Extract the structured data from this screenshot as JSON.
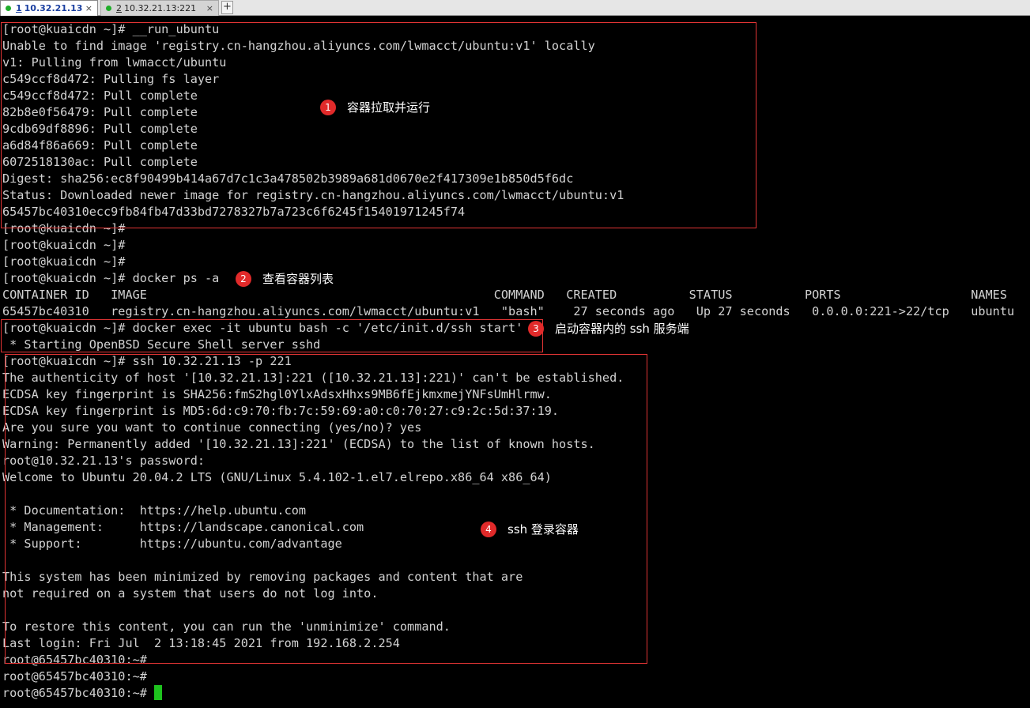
{
  "tabs": [
    {
      "num": "1",
      "host": "10.32.21.13",
      "close": "×"
    },
    {
      "num": "2",
      "host": "10.32.21.13:221",
      "close": "×"
    }
  ],
  "add_tab": "+",
  "terminal": {
    "lines": [
      "[root@kuaicdn ~]# __run_ubuntu",
      "Unable to find image 'registry.cn-hangzhou.aliyuncs.com/lwmacct/ubuntu:v1' locally",
      "v1: Pulling from lwmacct/ubuntu",
      "c549ccf8d472: Pulling fs layer",
      "c549ccf8d472: Pull complete",
      "82b8e0f56479: Pull complete",
      "9cdb69df8896: Pull complete",
      "a6d84f86a669: Pull complete",
      "6072518130ac: Pull complete",
      "Digest: sha256:ec8f90499b414a67d7c1c3a478502b3989a681d0670e2f417309e1b850d5f6dc",
      "Status: Downloaded newer image for registry.cn-hangzhou.aliyuncs.com/lwmacct/ubuntu:v1",
      "65457bc40310ecc9fb84fb47d33bd7278327b7a723c6f6245f15401971245f74",
      "[root@kuaicdn ~]#",
      "[root@kuaicdn ~]#",
      "[root@kuaicdn ~]#",
      "[root@kuaicdn ~]# docker ps -a",
      "CONTAINER ID   IMAGE                                                COMMAND   CREATED          STATUS          PORTS                  NAMES",
      "65457bc40310   registry.cn-hangzhou.aliyuncs.com/lwmacct/ubuntu:v1   \"bash\"    27 seconds ago   Up 27 seconds   0.0.0.0:221->22/tcp   ubuntu",
      "[root@kuaicdn ~]# docker exec -it ubuntu bash -c '/etc/init.d/ssh start'",
      " * Starting OpenBSD Secure Shell server sshd",
      "[root@kuaicdn ~]# ssh 10.32.21.13 -p 221",
      "The authenticity of host '[10.32.21.13]:221 ([10.32.21.13]:221)' can't be established.",
      "ECDSA key fingerprint is SHA256:fmS2hgl0YlxAdsxHhxs9MB6fEjkmxmejYNFsUmHlrmw.",
      "ECDSA key fingerprint is MD5:6d:c9:70:fb:7c:59:69:a0:c0:70:27:c9:2c:5d:37:19.",
      "Are you sure you want to continue connecting (yes/no)? yes",
      "Warning: Permanently added '[10.32.21.13]:221' (ECDSA) to the list of known hosts.",
      "root@10.32.21.13's password:",
      "Welcome to Ubuntu 20.04.2 LTS (GNU/Linux 5.4.102-1.el7.elrepo.x86_64 x86_64)",
      "",
      " * Documentation:  https://help.ubuntu.com",
      " * Management:     https://landscape.canonical.com",
      " * Support:        https://ubuntu.com/advantage",
      "",
      "This system has been minimized by removing packages and content that are",
      "not required on a system that users do not log into.",
      "",
      "To restore this content, you can run the 'unminimize' command.",
      "Last login: Fri Jul  2 13:18:45 2021 from 192.168.2.254",
      "root@65457bc40310:~#",
      "root@65457bc40310:~#",
      "root@65457bc40310:~# "
    ]
  },
  "annotations": [
    {
      "num": "1",
      "text": "容器拉取并运行"
    },
    {
      "num": "2",
      "text": "查看容器列表"
    },
    {
      "num": "3",
      "text": "启动容器内的 ssh 服务端"
    },
    {
      "num": "4",
      "text": "ssh 登录容器"
    }
  ],
  "colors": {
    "terminal_bg": "#000000",
    "terminal_fg": "#d2d2d2",
    "cursor": "#1ec21e",
    "highlight_box": "#e03434",
    "badge": "#e12a2a"
  }
}
